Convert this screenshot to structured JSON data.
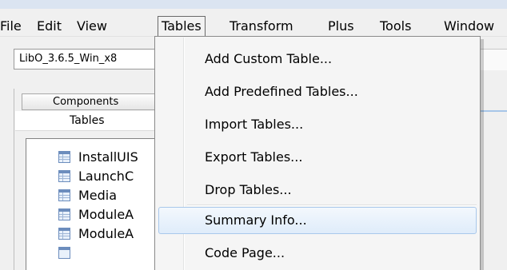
{
  "menubar": {
    "items": [
      {
        "label": "File"
      },
      {
        "label": "Edit"
      },
      {
        "label": "View"
      },
      {
        "label": "Tables"
      },
      {
        "label": "Transform"
      },
      {
        "label": "Plus"
      },
      {
        "label": "Tools"
      },
      {
        "label": "Window"
      }
    ]
  },
  "toolbar": {
    "database_combo_value": "LibO_3.6.5_Win_x8"
  },
  "tabs": {
    "components": "Components",
    "tables": "Tables"
  },
  "table_list": [
    {
      "label": "InstallUIS",
      "icon": "table-icon"
    },
    {
      "label": "LaunchC",
      "icon": "table-icon"
    },
    {
      "label": "Media",
      "icon": "table-icon"
    },
    {
      "label": "ModuleA",
      "icon": "table-icon"
    },
    {
      "label": "ModuleA",
      "icon": "table-icon"
    }
  ],
  "tables_menu": {
    "items": [
      {
        "label": "Add Custom Table..."
      },
      {
        "label": "Add Predefined Tables..."
      },
      {
        "label": "Import Tables..."
      },
      {
        "label": "Export Tables..."
      },
      {
        "label": "Drop Tables..."
      },
      {
        "label": "Summary Info..."
      },
      {
        "label": "Code Page..."
      }
    ],
    "highlighted": "Summary Info..."
  },
  "colors": {
    "menu_highlight_border": "#a9c8eb",
    "table_icon": "#6c8dbd"
  }
}
